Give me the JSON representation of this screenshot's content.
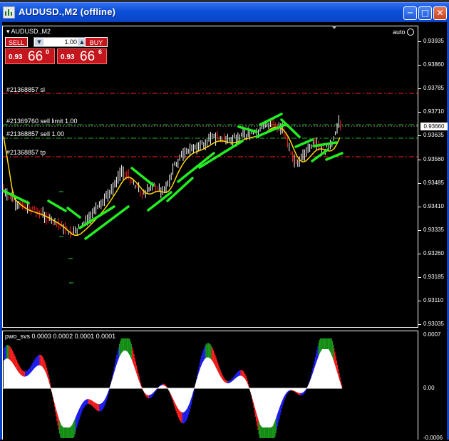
{
  "window": {
    "title": "AUDUSD.,M2 (offline)",
    "symbol_tab": "AUDUSD.,M2",
    "auto_label": "auto",
    "titlebar_color": "#0b4fd8"
  },
  "trade_panel": {
    "sell_label": "SELL",
    "buy_label": "BUY",
    "lot_value": "1.00",
    "sell_quote": {
      "prefix": "0.93",
      "big": "66",
      "sup": "0"
    },
    "buy_quote": {
      "prefix": "0.93",
      "big": "66",
      "sup": "6"
    }
  },
  "order_lines": [
    {
      "label": "#21368857 sl",
      "color": "#ff2020"
    },
    {
      "label": "#21369760 sell limit 1.00",
      "color": "#22b822"
    },
    {
      "label": "#21368857 sell 1.00",
      "color": "#22b822"
    },
    {
      "label": "#21368857 tp",
      "color": "#ff2020"
    }
  ],
  "price_axis": [
    "0.93935",
    "0.93860",
    "0.93785",
    "0.93710",
    "0.93635",
    "0.93560",
    "0.93485",
    "0.93410",
    "0.93335",
    "0.93260",
    "0.93185",
    "0.93110",
    "0.93035"
  ],
  "current_price": "0.93660",
  "indicator": {
    "label": "pwo_svs 0.0003 0.0002 0.0001 0.0001",
    "axis": [
      "0.0007",
      "0.00",
      "-0.0006"
    ]
  },
  "colors": {
    "bull_candle": "#ffffff",
    "bear_candle": "#ff2020",
    "ma_line": "#ffd700",
    "envelope": "#22ee22"
  }
}
